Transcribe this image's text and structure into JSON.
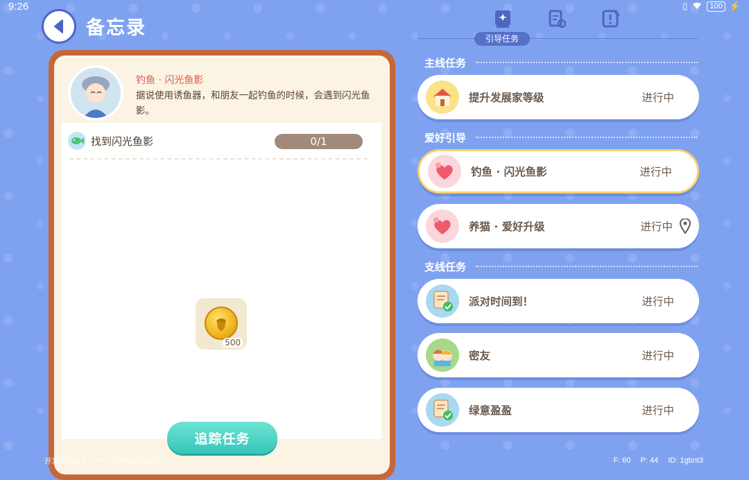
{
  "status_bar": {
    "time": "9:26",
    "battery": "100"
  },
  "header": {
    "title": "备忘录"
  },
  "quest_detail": {
    "name": "钓鱼 · 闪光鱼影",
    "description": "据说使用诱鱼器，和朋友一起钓鱼的时候，会遇到闪光鱼影。",
    "task": {
      "label": "找到闪光鱼影",
      "progress": "0/1"
    },
    "reward": {
      "count": "500",
      "icon": "acorn-coin-icon"
    },
    "track_button": "追踪任务"
  },
  "tabs": {
    "active_label": "引导任务",
    "icons": [
      "guide-book-icon",
      "clipboard-refresh-icon",
      "notebook-warning-icon"
    ]
  },
  "sections": {
    "main": {
      "title": "主线任务",
      "items": [
        {
          "name": "提升发展家等级",
          "status": "进行中",
          "icon": "house-icon"
        }
      ]
    },
    "hobby": {
      "title": "爱好引导",
      "items": [
        {
          "name": "钓鱼 · 闪光鱼影",
          "status": "进行中",
          "icon": "heart-bubble-icon"
        },
        {
          "name": "养猫 · 爱好升级",
          "status": "进行中",
          "icon": "heart-bubble-icon"
        }
      ]
    },
    "side": {
      "title": "支线任务",
      "items": [
        {
          "name": "派对时间到！",
          "status": "进行中",
          "icon": "note-check-icon"
        },
        {
          "name": "密友",
          "status": "进行中",
          "icon": "friends-icon"
        },
        {
          "name": "绿意盈盈",
          "status": "进行中",
          "icon": "note-check-icon"
        }
      ]
    }
  },
  "footer": {
    "disclaimer": "开发测试版本，不代表游戏最终品质",
    "fps": "F: 60",
    "ping": "P: 44",
    "id": "ID: 1gbnt3"
  },
  "colors": {
    "background": "#7fa2f0",
    "card_border": "#c6673a",
    "accent_teal": "#36c6b8",
    "highlight": "#f7d36c"
  }
}
